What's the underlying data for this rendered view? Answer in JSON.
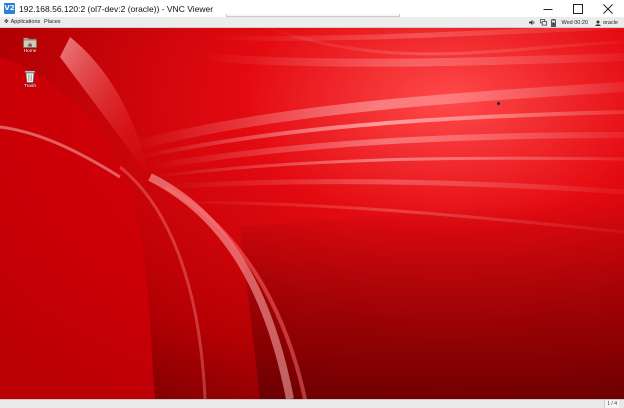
{
  "window": {
    "app_icon_text": "V2",
    "title": "192.168.56.120:2 (ol7-dev:2 (oracle)) - VNC Viewer",
    "controls": [
      "minimize-icon",
      "maximize-icon",
      "close-icon"
    ]
  },
  "remote_desktop": {
    "top_panel": {
      "applications": "Applications",
      "places": "Places",
      "tray_icons": [
        "volume-icon",
        "network-icon",
        "battery-icon"
      ],
      "clock": "Wed 00:20",
      "user": "oracle"
    },
    "desktop_icons": [
      {
        "label": "Home",
        "icon": "home-folder-icon"
      },
      {
        "label": "Trash",
        "icon": "trash-icon"
      }
    ],
    "wallpaper_colors": {
      "base": "#e0000a",
      "dark": "#7d0000",
      "highlight": "#ffd0d0"
    },
    "bottom_panel": {
      "workspace": "1 / 4"
    }
  }
}
